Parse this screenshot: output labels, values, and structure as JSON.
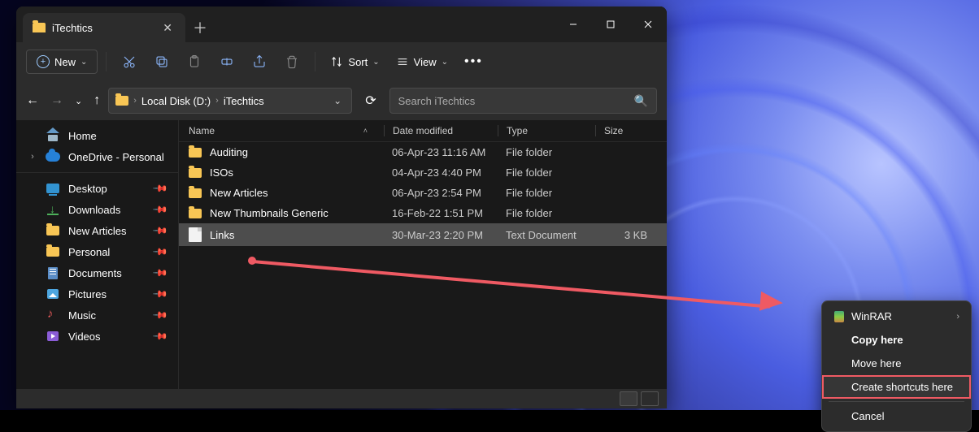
{
  "tab": {
    "title": "iTechtics"
  },
  "toolbar": {
    "new_label": "New",
    "sort_label": "Sort",
    "view_label": "View"
  },
  "address": {
    "crumbs": [
      "Local Disk (D:)",
      "iTechtics"
    ]
  },
  "search": {
    "placeholder": "Search iTechtics"
  },
  "columns": {
    "name": "Name",
    "date": "Date modified",
    "type": "Type",
    "size": "Size"
  },
  "sidebar": {
    "home": "Home",
    "onedrive": "OneDrive - Personal",
    "quick": [
      "Desktop",
      "Downloads",
      "New Articles",
      "Personal",
      "Documents",
      "Pictures",
      "Music",
      "Videos"
    ]
  },
  "rows": [
    {
      "name": "Auditing",
      "date": "06-Apr-23 11:16 AM",
      "type": "File folder",
      "size": "",
      "kind": "folder"
    },
    {
      "name": "ISOs",
      "date": "04-Apr-23 4:40 PM",
      "type": "File folder",
      "size": "",
      "kind": "folder"
    },
    {
      "name": "New Articles",
      "date": "06-Apr-23 2:54 PM",
      "type": "File folder",
      "size": "",
      "kind": "folder"
    },
    {
      "name": "New Thumbnails Generic",
      "date": "16-Feb-22 1:51 PM",
      "type": "File folder",
      "size": "",
      "kind": "folder"
    },
    {
      "name": "Links",
      "date": "30-Mar-23 2:20 PM",
      "type": "Text Document",
      "size": "3 KB",
      "kind": "file"
    }
  ],
  "context_menu": {
    "winrar": "WinRAR",
    "copy": "Copy here",
    "move": "Move here",
    "shortcut": "Create shortcuts here",
    "cancel": "Cancel"
  }
}
